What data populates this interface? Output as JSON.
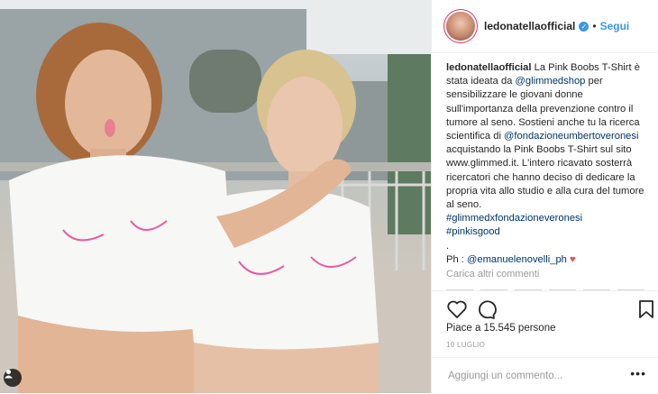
{
  "post": {
    "username": "ledonatellaofficial",
    "follow_label": "Segui",
    "separator": "•",
    "caption_user": "ledonatellaofficial",
    "caption_parts": {
      "p1": " La Pink Boobs T-Shirt è stata ideata da ",
      "m1": "@glimmedshop",
      "p2": " per sensibilizzare le giovani donne sull'importanza della prevenzione contro il tumore al seno. Sostieni anche tu la ricerca scientifica di ",
      "m2": "@fondazioneumbertoveronesi",
      "p3": " acquistando la Pink Boobs T-Shirt sul sito www.glimmed.it. L'intero ricavato sosterrà ricercatori che hanno deciso di dedicare la propria vita allo studio e alla cura del tumore al seno.",
      "h1": "#glimmedxfondazioneveronesi",
      "h2": "#pinkisgood",
      "dot": ".",
      "ph_label": "Ph : ",
      "m3": "@emanuelenovelli_ph",
      "heart": "♥"
    },
    "load_more": "Carica altri commenti",
    "likes": "Piace a 15.545 persone",
    "date": "10 LUGLIO",
    "comment_placeholder": "Aggiungi un commento...",
    "options": "•••"
  },
  "icons": {
    "like": "heart-outline-icon",
    "comment": "comment-bubble-icon",
    "save": "bookmark-icon",
    "tag": "user-tag-icon",
    "verified": "verified-badge-icon"
  },
  "colors": {
    "link": "#3897f0",
    "mention": "#003569",
    "heart": "#ed4956"
  }
}
